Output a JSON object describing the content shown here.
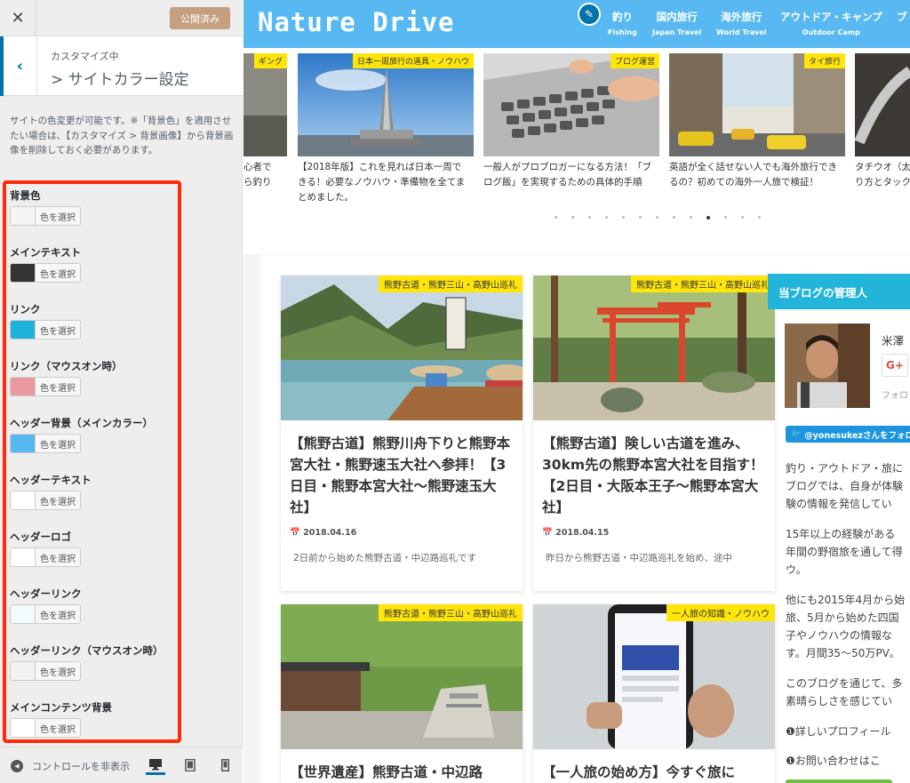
{
  "sidebar": {
    "publish_label": "公開済み",
    "section_sub": "カスタマイズ中",
    "section_title": "> サイトカラー設定",
    "description": "サイトの色変更が可能です。※「背景色」を適用させたい場合は、【カスタマイズ > 背景画像】から背景画像を削除しておく必要があります。",
    "pick_label": "色を選択",
    "color_controls": [
      {
        "label": "背景色",
        "color": "#f5f5f5"
      },
      {
        "label": "メインテキスト",
        "color": "#333333"
      },
      {
        "label": "リンク",
        "color": "#1fb2d9"
      },
      {
        "label": "リンク（マウスオン時）",
        "color": "#e89a9e"
      },
      {
        "label": "ヘッダー背景（メインカラー）",
        "color": "#58b9f2"
      },
      {
        "label": "ヘッダーテキスト",
        "color": "#ffffff"
      },
      {
        "label": "ヘッダーロゴ",
        "color": "#ffffff"
      },
      {
        "label": "ヘッダーリンク",
        "color": "#f2fafc"
      },
      {
        "label": "ヘッダーリンク（マウスオン時）",
        "color": "#f2f2f2"
      },
      {
        "label": "メインコンテンツ背景",
        "color": "#ffffff"
      }
    ],
    "hide_controls_label": "コントロールを非表示"
  },
  "header": {
    "logo": "Nature Drive",
    "nav": [
      {
        "label": "釣り",
        "sub": "Fishing"
      },
      {
        "label": "国内旅行",
        "sub": "Japan Travel"
      },
      {
        "label": "海外旅行",
        "sub": "World Travel"
      },
      {
        "label": "アウトドア・キャンプ",
        "sub": "Outdoor Camp"
      },
      {
        "label": "ブ",
        "sub": ""
      }
    ]
  },
  "carousel": {
    "slides": [
      {
        "tag": "ギング",
        "text": "心者で\nら釣り"
      },
      {
        "tag": "日本一周旅行の道具・ノウハウ",
        "text": "【2018年版】これを見れば日本一周で\nきる！必要なノウハウ・準備物を全てま\nとめました。"
      },
      {
        "tag": "ブログ運営",
        "text": "一般人がプロブロガーになる方法！「ブ\nログ飯」を実現するための具体的手順"
      },
      {
        "tag": "タイ旅行",
        "text": "英語が全く話せない人でも海外旅行でき\nるの？初めての海外一人旅で検証！"
      },
      {
        "tag": "",
        "text": "タチウオ（太\nり方とタック"
      }
    ]
  },
  "posts": [
    {
      "tag": "熊野古道・熊野三山・高野山巡礼",
      "title": "【熊野古道】熊野川舟下りと熊野本宮大社・熊野速玉大社へ参拝！【3日目・熊野本宮大社〜熊野速玉大社】",
      "date": "2018.04.16",
      "excerpt": "2日前から始めた熊野古道・中辺路巡礼です"
    },
    {
      "tag": "熊野古道・熊野三山・高野山巡礼",
      "title": "【熊野古道】険しい古道を進み、30km先の熊野本宮大社を目指す！【2日目・大阪本王子〜熊野本宮大社】",
      "date": "2018.04.15",
      "excerpt": "昨日から熊野古道・中辺路巡礼を始め、途中"
    },
    {
      "tag": "熊野古道・熊野三山・高野山巡礼",
      "title": "【世界遺産】熊野古道・中辺路",
      "date": "",
      "excerpt": ""
    },
    {
      "tag": "一人旅の知識・ノウハウ",
      "title": "【一人旅の始め方】今すぐ旅に",
      "date": "",
      "excerpt": ""
    }
  ],
  "widget": {
    "head": "当ブログの管理人",
    "author": "米澤",
    "gplus": "G+",
    "follow": "フォロ",
    "twitter": "@yonesukezさんをフォロ",
    "bio": [
      "釣り・アウトドア・旅に",
      "ブログでは、自身が体験",
      "験の情報を発信してい",
      "",
      "15年以上の経験がある",
      "年間の野宿旅を通して得",
      "ウ。",
      "",
      "他にも2015年4月から始",
      "旅、5月から始めた四国",
      "子やノウハウの情報な",
      "す。月間35〜50万PV。",
      "",
      "このブログを通じて、多",
      "素晴らしさを感じてい"
    ],
    "links": [
      "❶詳しいプロフィール",
      "❶お問い合わせはこ"
    ]
  }
}
